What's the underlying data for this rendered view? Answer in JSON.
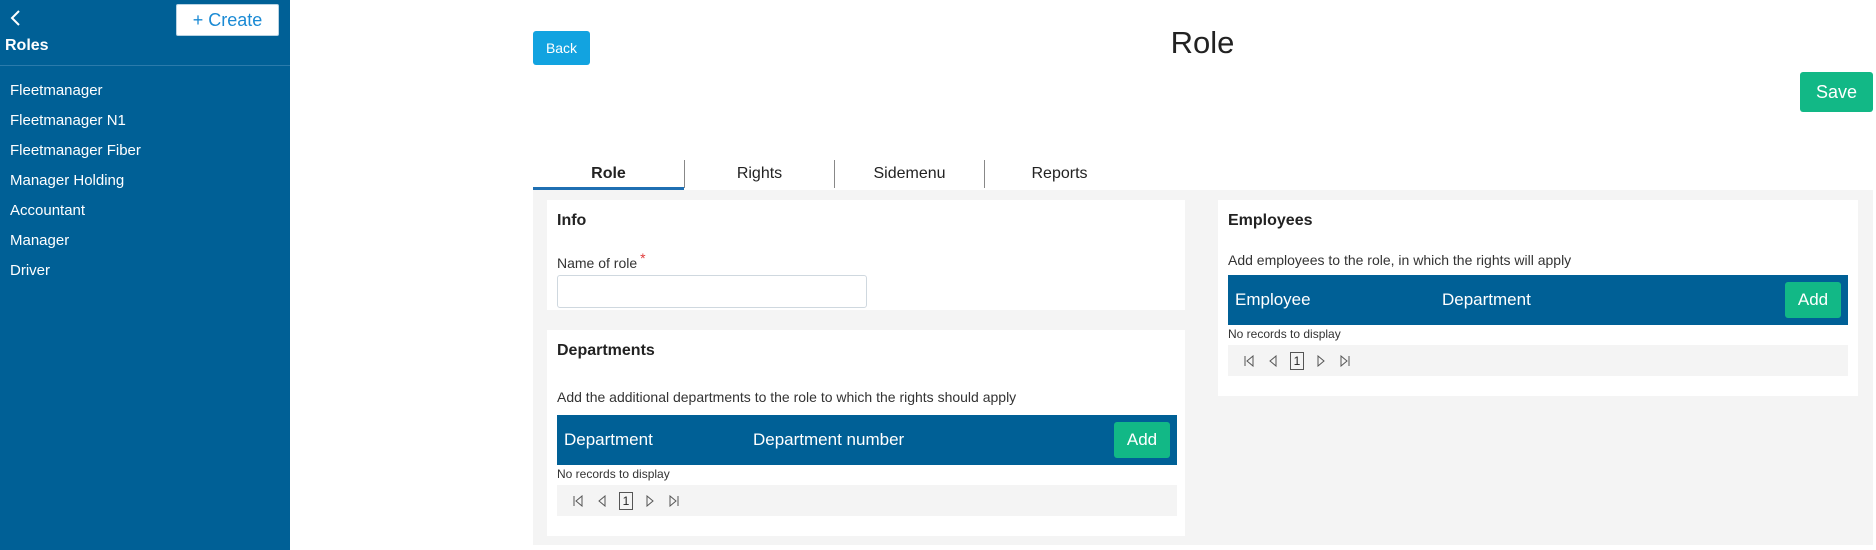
{
  "sidebar": {
    "title": "Roles",
    "create_label": "+ Create",
    "items": [
      "Fleetmanager",
      "Fleetmanager N1",
      "Fleetmanager Fiber",
      "Manager Holding",
      "Accountant",
      "Manager",
      "Driver"
    ]
  },
  "header": {
    "back_label": "Back",
    "title": "Role",
    "save_label": "Save"
  },
  "tabs": [
    "Role",
    "Rights",
    "Sidemenu",
    "Reports"
  ],
  "info": {
    "title": "Info",
    "name_label": "Name of role",
    "required_mark": "*",
    "name_value": ""
  },
  "departments": {
    "title": "Departments",
    "description": "Add the additional departments to the role to which the rights should apply",
    "columns": [
      "Department",
      "Department number"
    ],
    "add_label": "Add",
    "empty_text": "No records to display",
    "page": "1"
  },
  "employees": {
    "title": "Employees",
    "description": "Add employees to the role, in which the rights will apply",
    "columns": [
      "Employee",
      "Department"
    ],
    "add_label": "Add",
    "empty_text": "No records to display",
    "page": "1"
  },
  "colors": {
    "sidebar": "#006096",
    "accent": "#12a3e0",
    "success": "#12b886"
  }
}
